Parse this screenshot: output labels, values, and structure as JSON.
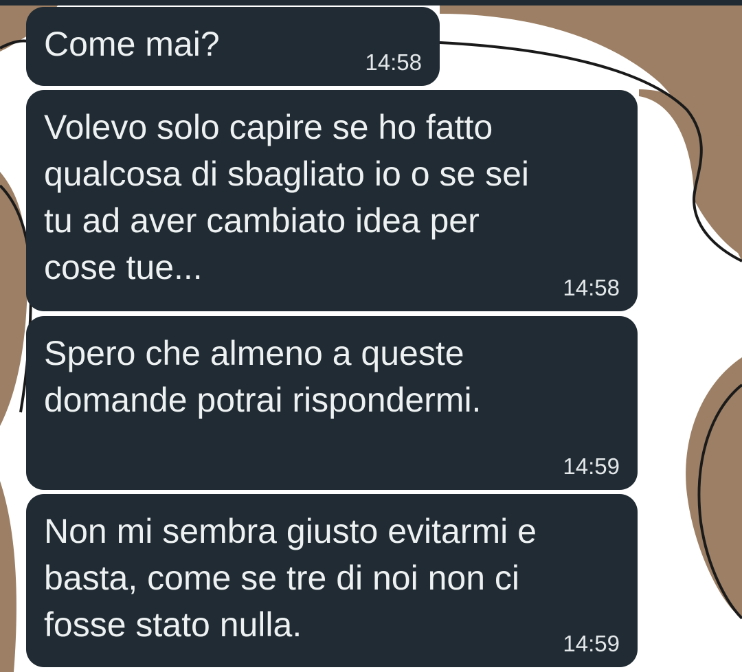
{
  "wallpaper": {
    "colors": {
      "blob": "#9c7f64",
      "background": "#ffffff",
      "outline": "#1a1a1a"
    }
  },
  "messages": [
    {
      "text": "Come mai?",
      "time": "14:58"
    },
    {
      "text": "Volevo solo capire se ho fatto\nqualcosa di sbagliato io o se sei\ntu ad aver cambiato idea per\ncose tue...",
      "time": "14:58"
    },
    {
      "text": "Spero che almeno a queste\ndomande potrai rispondermi.",
      "time": "14:59"
    },
    {
      "text": "Non mi sembra giusto evitarmi e\nbasta, come se tre di noi non ci\nfosse stato nulla.",
      "time": "14:59"
    }
  ],
  "colors": {
    "bubble": "#202b33",
    "text": "#eef1f2"
  }
}
